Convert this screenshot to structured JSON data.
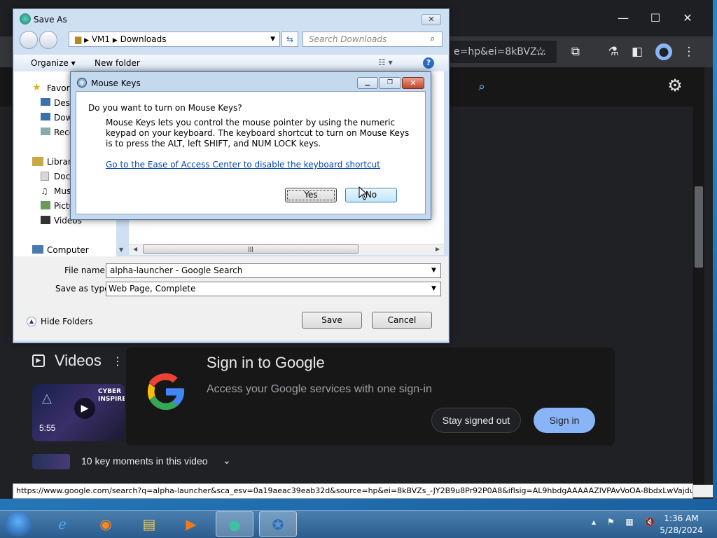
{
  "chrome": {
    "omnibox_text": "e=hp&ei=8kBVZ...",
    "settings_icon": "gear-icon",
    "statusbar_url": "https://www.google.com/search?q=alpha-launcher&sca_esv=0a19aeac39eab32d&source=hp&ei=8kBVZs_-JY2B9u8Pr92P0A8&iflsig=AL9hbdgAAAAAZlVPAvVoOA-8bdxLwVajdu..."
  },
  "videos": {
    "title": "Videos",
    "duration": "5:55",
    "thumb_text": "CYBER INSPIRE",
    "key_moments": "10 key moments in this video"
  },
  "signin": {
    "title": "Sign in to Google",
    "subtitle": "Access your Google services with one sign-in",
    "stay_signed_out": "Stay signed out",
    "sign_in": "Sign in"
  },
  "saveas": {
    "title": "Save As",
    "breadcrumb": [
      "VM1",
      "Downloads"
    ],
    "search_placeholder": "Search Downloads",
    "organize": "Organize ▾",
    "new_folder": "New folder",
    "nav": {
      "favorites": "Favori",
      "desktop": "Desk",
      "downloads": "Dow",
      "recent": "Rece",
      "libraries": "Librari",
      "documents": "Docu",
      "music": "Mus",
      "pictures": "Pictu",
      "videos": "Videos",
      "computer": "Computer"
    },
    "file_name_label": "File name:",
    "file_name_value": "alpha-launcher - Google Search",
    "save_type_label": "Save as type:",
    "save_type_value": "Web Page, Complete",
    "hide_folders": "Hide Folders",
    "save": "Save",
    "cancel": "Cancel"
  },
  "mousekeys": {
    "title": "Mouse Keys",
    "question": "Do you want to turn on Mouse Keys?",
    "body": "Mouse Keys lets you control the mouse pointer by using the numeric keypad on your keyboard.  The keyboard shortcut to turn on Mouse Keys is to press the ALT, left SHIFT, and NUM LOCK keys.",
    "link": "Go to the Ease of Access Center to disable the keyboard shortcut",
    "yes": "Yes",
    "no": "No"
  },
  "taskbar": {
    "time": "1:36 AM",
    "date": "5/28/2024"
  }
}
